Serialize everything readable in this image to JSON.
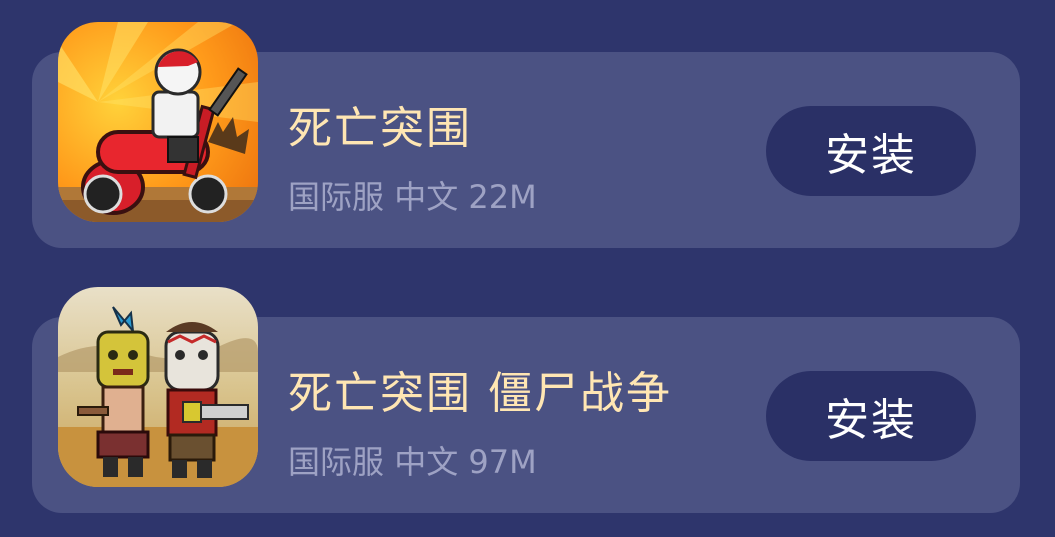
{
  "apps": [
    {
      "title": "死亡突围",
      "region": "国际服",
      "language": "中文",
      "size": "22M",
      "install_label": "安装",
      "icon": "biker-with-gun-game-icon"
    },
    {
      "title": "死亡突围 僵尸战争",
      "region": "国际服",
      "language": "中文",
      "size": "97M",
      "install_label": "安装",
      "icon": "masked-survivors-game-icon"
    }
  ],
  "colors": {
    "background": "#2e356c",
    "card": "#4b5283",
    "title": "#ffe6b3",
    "meta": "#9ea2c4",
    "button": "#2a3066",
    "button_text": "#ffffff"
  }
}
